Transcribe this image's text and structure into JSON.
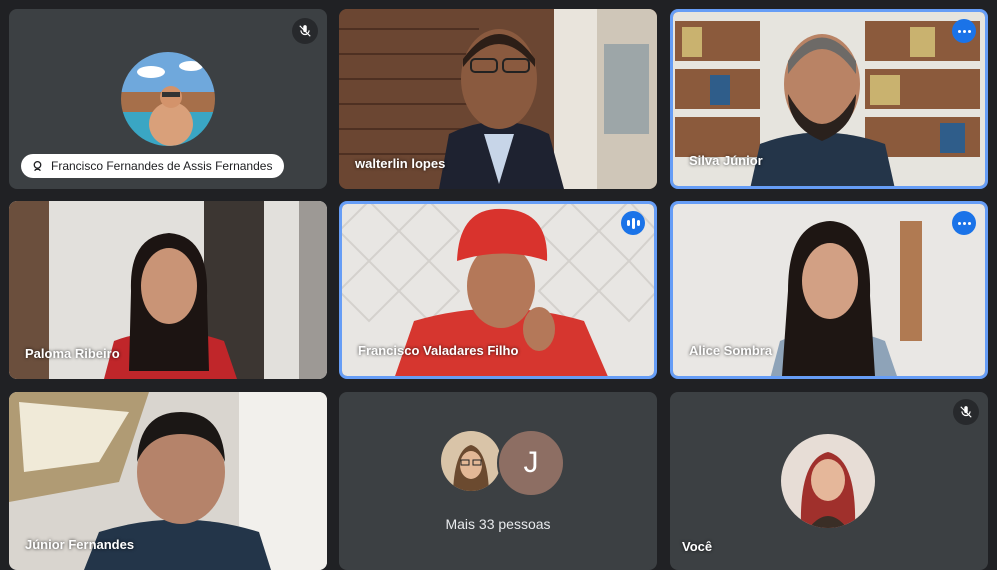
{
  "participants": [
    {
      "name": "Francisco Fernandes de Assis Fernandes"
    },
    {
      "name": "walterlin lopes"
    },
    {
      "name": "Silva Júnior"
    },
    {
      "name": "Paloma Ribeiro"
    },
    {
      "name": "Francisco Valadares Filho"
    },
    {
      "name": "Alice Sombra"
    },
    {
      "name": "Júnior Fernandes"
    },
    {
      "name": "Mais 33 pessoas",
      "avatar_letter": "J"
    },
    {
      "name": "Você"
    }
  ],
  "colors": {
    "background": "#202124",
    "tile": "#3c4043",
    "active_border": "#669df6",
    "accent": "#1a73e8",
    "letter_avatar": "#8d6e63"
  },
  "icons": [
    "mic-off-icon",
    "more-options-icon",
    "speaking-indicator-icon",
    "pin-icon"
  ]
}
